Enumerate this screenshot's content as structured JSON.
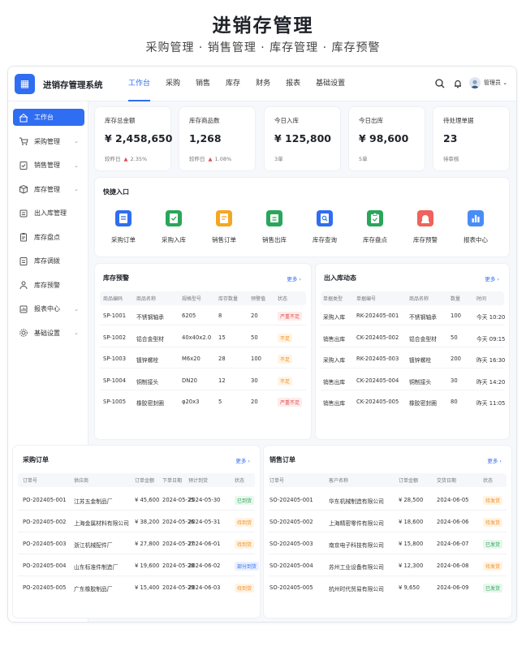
{
  "hero": {
    "title": "进销存管理",
    "subtitle": "采购管理 · 销售管理 · 库存管理 · 库存预警"
  },
  "topbar": {
    "logo_glyph": "▦",
    "system_name": "进销存管理系统",
    "tabs": [
      {
        "label": "工作台",
        "active": true
      },
      {
        "label": "采购",
        "active": false
      },
      {
        "label": "销售",
        "active": false
      },
      {
        "label": "库存",
        "active": false
      },
      {
        "label": "财务",
        "active": false
      },
      {
        "label": "报表",
        "active": false
      },
      {
        "label": "基础设置",
        "active": false
      }
    ],
    "icons": [
      "search-icon",
      "bell-icon",
      "avatar"
    ],
    "user_label": "管理员 ⌄"
  },
  "sidebar": {
    "items": [
      {
        "label": "工作台",
        "icon": "home-icon",
        "active": true,
        "chevron": ""
      },
      {
        "label": "采购管理",
        "icon": "cart-icon",
        "active": false,
        "chevron": "⌄"
      },
      {
        "label": "销售管理",
        "icon": "sales-icon",
        "active": false,
        "chevron": "⌄"
      },
      {
        "label": "库存管理",
        "icon": "box-icon",
        "active": false,
        "chevron": "⌄"
      },
      {
        "label": "出入库管理",
        "icon": "inout-icon",
        "active": false,
        "chevron": ""
      },
      {
        "label": "库存盘点",
        "icon": "clipboard-icon",
        "active": false,
        "chevron": ""
      },
      {
        "label": "库存调拨",
        "icon": "transfer-icon",
        "active": false,
        "chevron": ""
      },
      {
        "label": "库存预警",
        "icon": "bell-icon",
        "active": false,
        "chevron": ""
      },
      {
        "label": "报表中心",
        "icon": "report-icon",
        "active": false,
        "chevron": "⌄"
      },
      {
        "label": "基础设置",
        "icon": "gear-icon",
        "active": false,
        "chevron": "⌄"
      }
    ]
  },
  "kpis": [
    {
      "label": "库存总金额",
      "value": "¥ 2,458,650",
      "foot_prefix": "较昨日",
      "foot_arrow": "▲",
      "foot_change": "2.35%"
    },
    {
      "label": "库存商品数",
      "value": "1,268",
      "foot_prefix": "较昨日",
      "foot_arrow": "▲",
      "foot_change": "1.08%"
    },
    {
      "label": "今日入库",
      "value": "¥ 125,800",
      "foot_prefix": "3单",
      "foot_arrow": "",
      "foot_change": ""
    },
    {
      "label": "今日出库",
      "value": "¥ 98,600",
      "foot_prefix": "5单",
      "foot_arrow": "",
      "foot_change": ""
    },
    {
      "label": "待处理单据",
      "value": "23",
      "foot_prefix": "待审核",
      "foot_arrow": "",
      "foot_change": ""
    }
  ],
  "quick_access": {
    "title": "快捷入口",
    "items": [
      {
        "label": "采购订单",
        "color": "#2f6ef2",
        "icon": "purchase-order-icon"
      },
      {
        "label": "采购入库",
        "color": "#2aa65a",
        "icon": "purchase-in-icon"
      },
      {
        "label": "销售订单",
        "color": "#f5a623",
        "icon": "sales-order-icon"
      },
      {
        "label": "销售出库",
        "color": "#2aa65a",
        "icon": "sales-out-icon"
      },
      {
        "label": "库存查询",
        "color": "#2f6ef2",
        "icon": "stock-search-icon"
      },
      {
        "label": "库存盘点",
        "color": "#2aa65a",
        "icon": "stock-check-icon"
      },
      {
        "label": "库存预警",
        "color": "#f0625c",
        "icon": "alert-icon"
      },
      {
        "label": "报表中心",
        "color": "#4a8cf7",
        "icon": "chart-icon"
      }
    ]
  },
  "stock_alert": {
    "title": "库存预警",
    "more": "更多 ›",
    "columns": [
      "商品编码",
      "商品名称",
      "规格型号",
      "库存数量",
      "预警值",
      "状态"
    ],
    "rows": [
      [
        "SP-1001",
        "不锈钢轴承",
        "6205",
        "8",
        "20",
        "严重不足"
      ],
      [
        "SP-1002",
        "铝合金型材",
        "40x40x2.0",
        "15",
        "50",
        "不足"
      ],
      [
        "SP-1003",
        "镀锌螺栓",
        "M6x20",
        "28",
        "100",
        "不足"
      ],
      [
        "SP-1004",
        "铜制接头",
        "DN20",
        "12",
        "30",
        "不足"
      ],
      [
        "SP-1005",
        "橡胶密封圈",
        "φ20x3",
        "5",
        "20",
        "严重不足"
      ]
    ]
  },
  "inout": {
    "title": "出入库动态",
    "more": "更多 ›",
    "columns": [
      "单据类型",
      "单据编号",
      "商品名称",
      "数量",
      "时间"
    ],
    "rows": [
      [
        "采购入库",
        "RK-202405-001",
        "不锈钢轴承",
        "100",
        "今天 10:20"
      ],
      [
        "销售出库",
        "CK-202405-002",
        "铝合金型材",
        "50",
        "今天 09:15"
      ],
      [
        "采购入库",
        "RK-202405-003",
        "镀锌螺栓",
        "200",
        "昨天 16:30"
      ],
      [
        "销售出库",
        "CK-202405-004",
        "铜制接头",
        "30",
        "昨天 14:20"
      ],
      [
        "销售出库",
        "CK-202405-005",
        "橡胶密封圈",
        "80",
        "昨天 11:05"
      ]
    ]
  },
  "purchase_orders": {
    "title": "采购订单",
    "more": "更多 ›",
    "columns": [
      "订单号",
      "供应商",
      "订单金额",
      "下单日期",
      "预计到货",
      "状态"
    ],
    "rows": [
      [
        "PO-202405-001",
        "江苏五金制品厂",
        "¥ 45,600",
        "2024-05-25",
        "2024-05-30",
        "已到货"
      ],
      [
        "PO-202405-002",
        "上海金属材料有限公司",
        "¥ 38,200",
        "2024-05-26",
        "2024-05-31",
        "待到货"
      ],
      [
        "PO-202405-003",
        "浙江机械配件厂",
        "¥ 27,800",
        "2024-05-27",
        "2024-06-01",
        "待到货"
      ],
      [
        "PO-202405-004",
        "山东标准件制造厂",
        "¥ 19,600",
        "2024-05-28",
        "2024-06-02",
        "部分到货"
      ],
      [
        "PO-202405-005",
        "广东橡胶制品厂",
        "¥ 15,400",
        "2024-05-29",
        "2024-06-03",
        "待到货"
      ]
    ]
  },
  "sales_orders": {
    "title": "销售订单",
    "more": "更多 ›",
    "columns": [
      "订单号",
      "客户名称",
      "订单金额",
      "交货日期",
      "状态"
    ],
    "rows": [
      [
        "SO-202405-001",
        "华东机械制造有限公司",
        "¥ 28,500",
        "2024-06-05",
        "待发货"
      ],
      [
        "SO-202405-002",
        "上海精密零件有限公司",
        "¥ 18,600",
        "2024-06-06",
        "待发货"
      ],
      [
        "SO-202405-003",
        "南京电子科技有限公司",
        "¥ 15,800",
        "2024-06-07",
        "已发货"
      ],
      [
        "SO-202405-004",
        "苏州工业设备有限公司",
        "¥ 12,300",
        "2024-06-08",
        "待发货"
      ],
      [
        "SO-202405-005",
        "杭州时代贸易有限公司",
        "¥ 9,650",
        "2024-06-09",
        "已发货"
      ]
    ]
  },
  "status_colors": {
    "严重不足": "red",
    "不足": "orange",
    "已到货": "green",
    "待到货": "orange",
    "部分到货": "blue",
    "待发货": "orange",
    "已发货": "green"
  }
}
